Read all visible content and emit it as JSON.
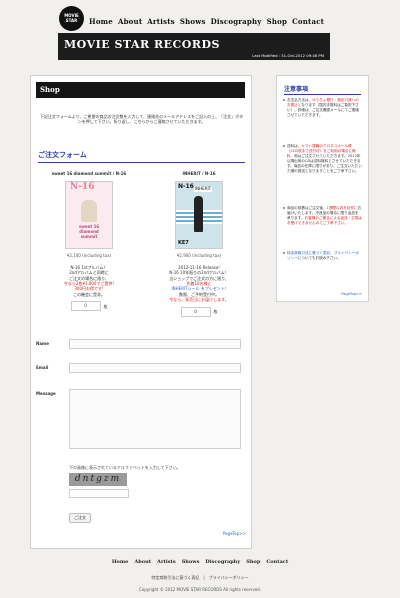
{
  "header": {
    "logo_text": [
      "MOVIE",
      "STAR"
    ],
    "nav": [
      "Home",
      "About",
      "Artists",
      "Shows",
      "Discography",
      "Shop",
      "Contact"
    ],
    "site_title": "MOVIE STAR RECORDS",
    "last_modified": "Last Modified : 31-Oct-2012 09:46 PM"
  },
  "main": {
    "section_title": "Shop",
    "intro": "下記注文フォームより、ご希望の商品の注文数を入力して、連絡先のメールアドレスをご記入の上、「注文」ボタンを押して下さい。折り返し、こちらからご連絡させていただきます。",
    "form_title": "ご注文フォーム",
    "products": [
      {
        "title": "sweet 16 diamond summit / N-16",
        "cover_brand": "N-16",
        "cover_text": "sweet 16 diamond summit",
        "price": "¥2,100 (including tax)",
        "lines": [
          "N-16 1stアルバム！",
          "2ndアルバムと同時に",
          "ご注文の場合に限り、"
        ],
        "highlight": [
          "今なら2枚¥3,800でご提供!",
          "300円お得です!"
        ],
        "closing": "この機会に是非。",
        "qty_value": "0",
        "qty_unit": "枚"
      },
      {
        "title": "INHERIT / N-16",
        "cover_brand": "N-16",
        "cover_label": "INHERIT",
        "cover_number": "KE7",
        "price": "¥2,900 (including tax)",
        "lines": [
          "2012-11-16 Release!",
          "N-16 10年振りの2ndアルバム！",
          "当ショップでご注文の方に限り、"
        ],
        "highlight": [
          "先着10名様に",
          "INHERITシール をプレゼント!"
        ],
        "closing": [
          "数限、ご予約受付中。",
          "今なら、発売日にお届けします。"
        ],
        "qty_value": "0",
        "qty_unit": "枚"
      }
    ],
    "fields": {
      "name": "Name",
      "email": "Email",
      "message": "Message"
    },
    "captcha_note": "下の画像に表示されているアルファベットを入力して下さい。",
    "captcha_text": "dntgzm",
    "submit_label": "ご注文",
    "pagetop": "PageTop>>"
  },
  "side": {
    "title": "注意事項",
    "notes": [
      [
        "お支払方法は、",
        "ゆうちょ銀行・指定口座へのお振込",
        "となります（国内手数料はご負担下さい）。詳細は、ご注文確認メールにてご連絡させていただきます。"
      ],
      [
        "送料は、",
        "ヤマト運輸のクロネコメール便（CD2枚まで送付可）をご利用の場合に無料、",
        "他はご注文させていただきます。2012年以降出荷のCDは送料無料とさせていただきます。商品の在庫に限りがあり、ご注文いただいた順の発送となりますことをご了承下さい。"
      ],
      [
        "商品の到着はご注文後、",
        "1週間以内を目安に",
        "お届けいたします。不良品の場合に限り返品を承ります。",
        "お客様のご都合による返品・交換はお受けできませんのでご了承下さい。"
      ]
    ],
    "links": [
      "特定商取引法に基づく表記",
      "プライバシーポリシー"
    ],
    "links_tail": "についてもお読み下さい。",
    "pagetop": "PageTop>>"
  },
  "footer": {
    "nav": [
      "Home",
      "About",
      "Artists",
      "Shows",
      "Discography",
      "Shop",
      "Contact"
    ],
    "links": "特定商取引法に基づく表記　|　プライバシーポリシー",
    "copyright": "Copyright © 2012 MOVIE STAR RECORDS All rights reserved."
  }
}
